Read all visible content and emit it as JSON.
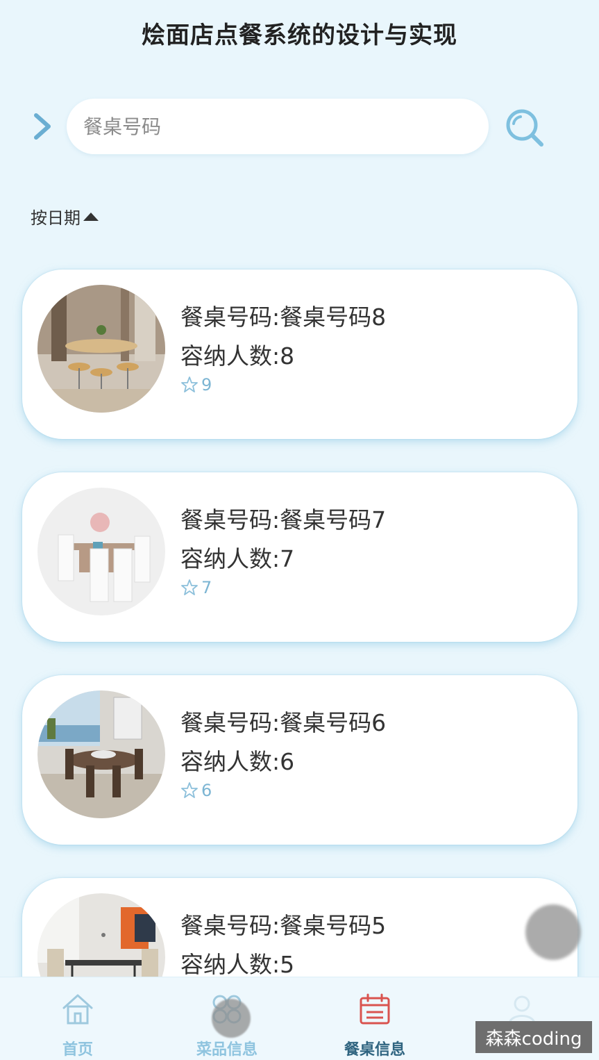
{
  "header": {
    "title": "烩面店点餐系统的设计与实现"
  },
  "search": {
    "placeholder": "餐桌号码"
  },
  "sort": {
    "label": "按日期"
  },
  "cards": [
    {
      "title": "餐桌号码:餐桌号码8",
      "capacity": "容纳人数:8",
      "favorites": "9"
    },
    {
      "title": "餐桌号码:餐桌号码7",
      "capacity": "容纳人数:7",
      "favorites": "7"
    },
    {
      "title": "餐桌号码:餐桌号码6",
      "capacity": "容纳人数:6",
      "favorites": "6"
    },
    {
      "title": "餐桌号码:餐桌号码5",
      "capacity": "容纳人数:5",
      "favorites": ""
    }
  ],
  "tabbar": {
    "items": [
      {
        "label": "首页",
        "icon": "home-icon"
      },
      {
        "label": "菜品信息",
        "icon": "dish-icon"
      },
      {
        "label": "餐桌信息",
        "icon": "calendar-icon",
        "active": true
      },
      {
        "label": "",
        "icon": "user-icon"
      }
    ]
  },
  "watermark": "森森coding",
  "colors": {
    "accent": "#7cb5d3",
    "active": "#d9534f",
    "background": "#e9f6fc"
  }
}
